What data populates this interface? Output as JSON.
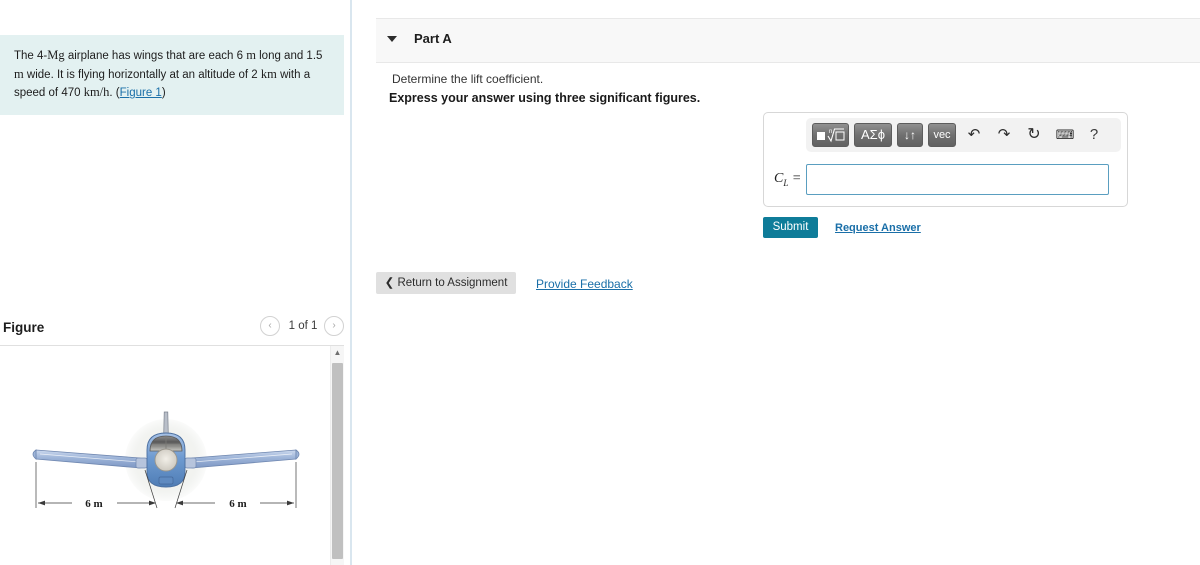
{
  "problem": {
    "text_part1": "The 4-",
    "mass_unit": "Mg",
    "text_part2": " airplane has wings that are each 6 ",
    "length_unit": "m",
    "text_part3": " long and 1.5 ",
    "width_unit": "m",
    "text_part4": " wide. It is flying horizontally at an altitude of 2 ",
    "altitude_unit": "km",
    "text_part5": " with a speed of 470 ",
    "speed_unit": "km/h",
    "text_part6": ". (",
    "figure_link": "Figure 1",
    "text_part7": ")"
  },
  "figure": {
    "title": "Figure",
    "pager_label": "1 of 1",
    "prev_icon": "‹",
    "next_icon": "›",
    "scroll_up_icon": "▲",
    "dimension_left": "6 m",
    "dimension_right": "6 m"
  },
  "part": {
    "title": "Part A",
    "question": "Determine the lift coefficient.",
    "instruction": "Express your answer using three significant figures."
  },
  "toolbar": {
    "template_label": "",
    "greek_label": "ΑΣϕ",
    "subsup_label": "↓↑",
    "vec_label": "vec",
    "undo_icon": "↶",
    "redo_icon": "↷",
    "reset_icon": "↻",
    "keyboard_icon": "⌨",
    "help_icon": "?"
  },
  "answer": {
    "label_symbol": "C",
    "label_subscript": "L",
    "label_equals": " =",
    "value": "",
    "placeholder": ""
  },
  "actions": {
    "submit_label": "Submit",
    "request_answer_label": "Request Answer",
    "return_label": "Return to Assignment",
    "return_chevron": "❮",
    "provide_feedback_label": "Provide Feedback"
  },
  "colors": {
    "problem_bg": "#e3f1f1",
    "submit_bg": "#0e7c99",
    "link": "#1a6fa8",
    "input_border": "#5a9ec0",
    "header_bg": "#f8f8f8",
    "wing_blue": "#a8bede",
    "fuselage_blue": "#6f9bd1"
  }
}
